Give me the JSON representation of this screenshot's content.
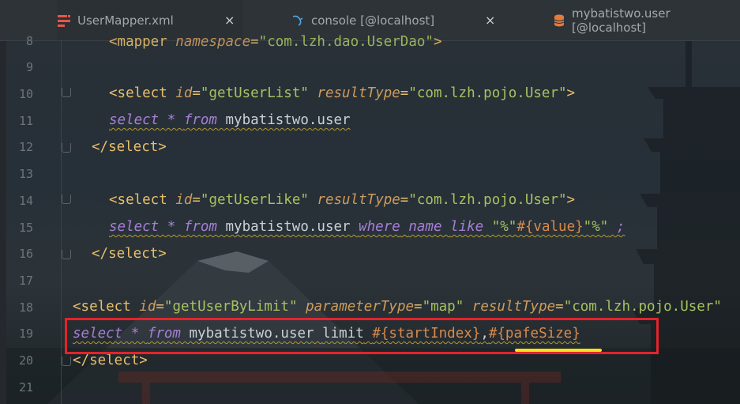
{
  "tabs": [
    {
      "label": "UserMapper.xml",
      "icon": "xml-mapper-icon",
      "active": true
    },
    {
      "label": "console [@localhost]",
      "icon": "console-icon",
      "active": false
    },
    {
      "label": "mybatistwo.user [@localhost]",
      "icon": "database-table-icon",
      "active": false
    }
  ],
  "close_glyph": "×",
  "lines": [
    {
      "number": "8",
      "text": "<mapper namespace=\"com.lzh.dao.UserDao\">"
    },
    {
      "number": "9",
      "text": ""
    },
    {
      "number": "10",
      "text": "<select id=\"getUserList\" resultType=\"com.lzh.pojo.User\">"
    },
    {
      "number": "11",
      "text": "select * from mybatistwo.user"
    },
    {
      "number": "12",
      "text": "</select>"
    },
    {
      "number": "13",
      "text": ""
    },
    {
      "number": "14",
      "text": "<select id=\"getUserLike\" resultType=\"com.lzh.pojo.User\">"
    },
    {
      "number": "15",
      "text": "select * from mybatistwo.user where name like \"%\"#{value}\"%\" ;"
    },
    {
      "number": "16",
      "text": "</select>"
    },
    {
      "number": "17",
      "text": ""
    },
    {
      "number": "18",
      "text": "<select id=\"getUserByLimit\" parameterType=\"map\" resultType=\"com.lzh.pojo.User\">"
    },
    {
      "number": "19",
      "text": "select * from mybatistwo.user limit #{startIndex},#{pafeSize}"
    },
    {
      "number": "20",
      "text": "</select>"
    },
    {
      "number": "21",
      "text": ""
    }
  ],
  "tokens": {
    "l8": {
      "open": "<mapper ",
      "attr": "namespace",
      "eq": "=",
      "val": "\"com.lzh.dao.UserDao\"",
      "close": ">"
    },
    "l10": {
      "open": "<select ",
      "a1": "id",
      "v1": "\"getUserList\"",
      "a2": "resultType",
      "v2": "\"com.lzh.pojo.User\"",
      "close": ">"
    },
    "l11": {
      "k1": "select",
      "star": " * ",
      "k2": "from",
      "tbl": " mybatistwo.user"
    },
    "l12": {
      "tag": "</select>"
    },
    "l14": {
      "open": "<select ",
      "a1": "id",
      "v1": "\"getUserLike\"",
      "a2": "resultType",
      "v2": "\"com.lzh.pojo.User\"",
      "close": ">"
    },
    "l15": {
      "k1": "select",
      "star": " * ",
      "k2": "from",
      "tbl": " mybatistwo.user ",
      "k3": "where",
      "sp": " ",
      "k4": "name",
      "sp2": " ",
      "k5": "like",
      "s1": " \"%\"",
      "p1": "#{value}",
      "s2": "\"%\"",
      "end": " ;"
    },
    "l16": {
      "tag": "</select>"
    },
    "l18": {
      "open": "<select ",
      "a1": "id",
      "v1": "\"getUserByLimit\"",
      "a2": "parameterType",
      "v2": "\"map\"",
      "a3": "resultType",
      "v3": "\"com.lzh.pojo.User\""
    },
    "l19": {
      "k1": "select",
      "star": " * ",
      "k2": "from",
      "tbl": " mybatistwo.user ",
      "kw": "limit",
      "sp": " ",
      "p1": "#{startIndex}",
      "comma": ",",
      "p2": "#{pafeSize}"
    },
    "l20": {
      "tag": "</select>"
    }
  },
  "annotations": {
    "highlight_box_color": "#e3242b",
    "underline_color": "#f4e21a"
  }
}
